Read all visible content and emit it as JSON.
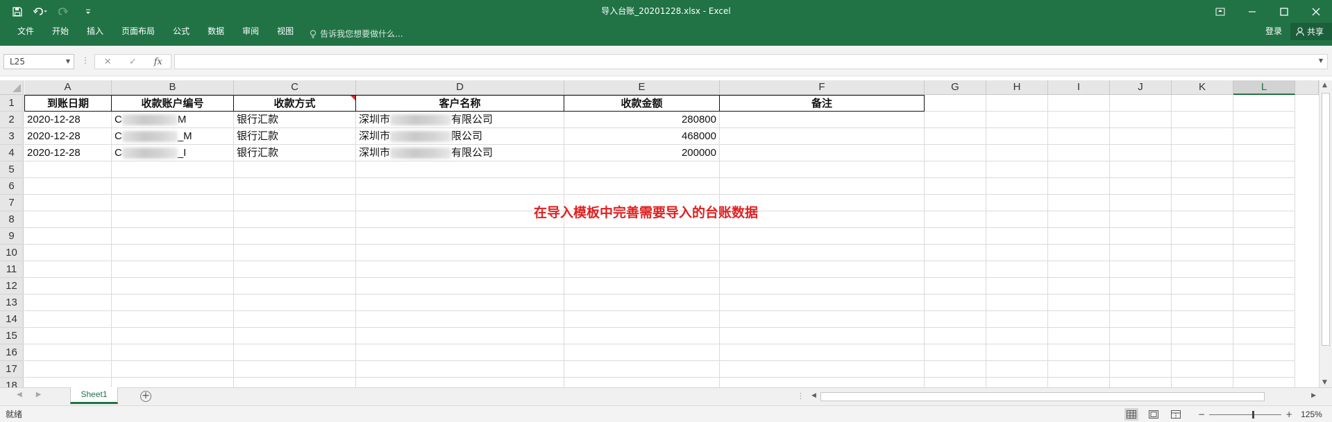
{
  "window": {
    "title": "导入台账_20201228.xlsx - Excel"
  },
  "ribbon": {
    "tabs": [
      "文件",
      "开始",
      "插入",
      "页面布局",
      "公式",
      "数据",
      "审阅",
      "视图"
    ],
    "tell_me": "告诉我您想要做什么...",
    "login": "登录",
    "share": "共享"
  },
  "formula_bar": {
    "name_box": "L25",
    "fx": "fx",
    "value": ""
  },
  "sheet": {
    "columns": [
      "A",
      "B",
      "C",
      "D",
      "E",
      "F",
      "G",
      "H",
      "I",
      "J",
      "K",
      "L"
    ],
    "selected_column": "L",
    "row_numbers": [
      "1",
      "2",
      "3",
      "4",
      "5",
      "6",
      "7",
      "8",
      "9",
      "10",
      "11",
      "12",
      "13",
      "14",
      "15",
      "16",
      "17",
      "18"
    ],
    "headers": [
      "到账日期",
      "收款账户编号",
      "收款方式",
      "客户名称",
      "收款金额",
      "备注"
    ],
    "rows": [
      {
        "date": "2020-12-28",
        "account_prefix": "C",
        "account_suffix": "M",
        "method": "银行汇款",
        "customer_prefix": "深圳市",
        "customer_suffix": "有限公司",
        "amount": "280800",
        "note": ""
      },
      {
        "date": "2020-12-28",
        "account_prefix": "C",
        "account_suffix": "_M",
        "method": "银行汇款",
        "customer_prefix": "深圳市",
        "customer_suffix": "限公司",
        "amount": "468000",
        "note": ""
      },
      {
        "date": "2020-12-28",
        "account_prefix": "C",
        "account_suffix": "_I",
        "method": "银行汇款",
        "customer_prefix": "深圳市",
        "customer_suffix": "有限公司",
        "amount": "200000",
        "note": ""
      }
    ],
    "annotation": "在导入模板中完善需要导入的台账数据",
    "annotation_color": "#e02020"
  },
  "sheet_tabs": {
    "active": "Sheet1",
    "add_label": "+"
  },
  "status": {
    "text": "就绪",
    "zoom": "125%"
  },
  "theme": {
    "accent": "#217346"
  }
}
